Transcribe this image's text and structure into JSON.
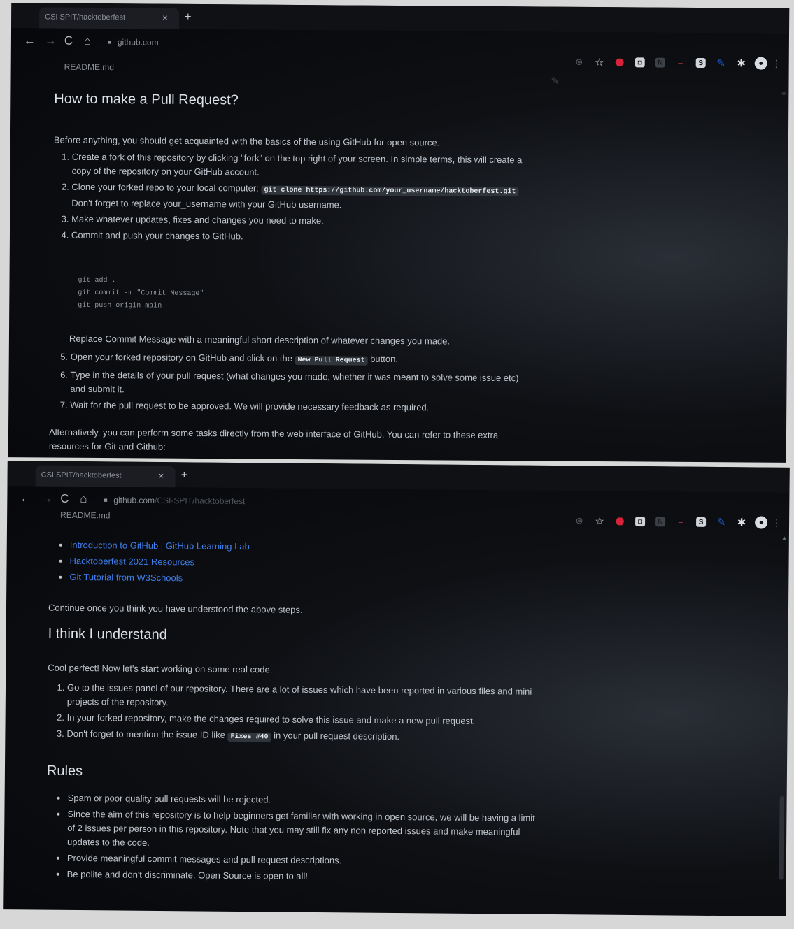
{
  "top": {
    "tab": {
      "title": "CSI SPIT/hacktoberfest",
      "close": "×",
      "new_tab": "+"
    },
    "nav": {
      "back": "←",
      "forward": "→",
      "reload": "C",
      "home": "⌂",
      "lock": "■",
      "url": "github.com",
      "url_path": ""
    },
    "filename": "README.md",
    "heading": "How to make a Pull Request?",
    "intro": "Before anything, you should get acquainted with the basics of the using GitHub for open source.",
    "steps": [
      "Create a fork of this repository by clicking \"fork\" on the top right of your screen. In simple terms, this will create a copy of the repository on your GitHub account.",
      {
        "pre": "Clone your forked repo to your local computer: ",
        "code": "git clone https://github.com/your_username/hacktoberfest.git",
        "post": " Don't forget to replace your_username with your GitHub username."
      },
      "Make whatever updates, fixes and changes you need to make.",
      "Commit and push your changes to GitHub."
    ],
    "code_block": "git add .\ngit commit -m \"Commit Message\"\ngit push origin main",
    "replace_note": "Replace Commit Message with a meaningful short description of whatever changes you made.",
    "steps_b": [
      {
        "pre": "Open your forked repository on GitHub and click on the ",
        "code": "New Pull Request",
        "post": " button."
      },
      "Type in the details of your pull request (what changes you made, whether it was meant to solve some issue etc) and submit it.",
      "Wait for the pull request to be approved. We will provide necessary feedback as required."
    ],
    "alt_text": "Alternatively, you can perform some tasks directly from the web interface of GitHub. You can refer to these extra resources for Git and Github:"
  },
  "bottom": {
    "tab": {
      "title": "CSI SPIT/hacktoberfest",
      "close": "×",
      "new_tab": "+"
    },
    "nav": {
      "back": "←",
      "forward": "→",
      "reload": "C",
      "home": "⌂",
      "lock": "■",
      "url": "github.com",
      "url_path": "/CSI-SPIT/hacktoberfest"
    },
    "filename": "README.md",
    "resources": [
      "Introduction to GitHub | GitHub Learning Lab",
      "Hacktoberfest 2021 Resources",
      "Git Tutorial from W3Schools"
    ],
    "continue_text": "Continue once you think you have understood the above steps.",
    "heading_understand": "I think I understand",
    "cool_text": "Cool perfect! Now let's start working on some real code.",
    "steps": [
      "Go to the issues panel of our repository. There are a lot of issues which have been reported in various files and mini projects of the repository.",
      "In your forked repository, make the changes required to solve this issue and make a new pull request.",
      {
        "pre": "Don't forget to mention the issue ID like ",
        "code": "Fixes #40",
        "post": " in your pull request description."
      }
    ],
    "heading_rules": "Rules",
    "rules": [
      "Spam or poor quality pull requests will be rejected.",
      "Since the aim of this repository is to help beginners get familiar with working in open source, we will be having a limit of 2 issues per person in this repository. Note that you may still fix any non reported issues and make meaningful updates to the code.",
      "Provide meaningful commit messages and pull request descriptions.",
      "Be polite and don't discriminate. Open Source is open to all!"
    ]
  },
  "extensions": [
    "tag-icon",
    "star-icon",
    "red-tag-icon",
    "box-icon",
    "notion-icon",
    "dash-icon",
    "s-icon",
    "blue-pen-icon",
    "puzzle-icon",
    "avatar",
    "menu-icon"
  ],
  "colors": {
    "page_bg": "#0d1117",
    "link": "#3f7de8",
    "text": "#c9d1d9",
    "heading": "#dde2e8",
    "code_bg": "#30353c"
  }
}
